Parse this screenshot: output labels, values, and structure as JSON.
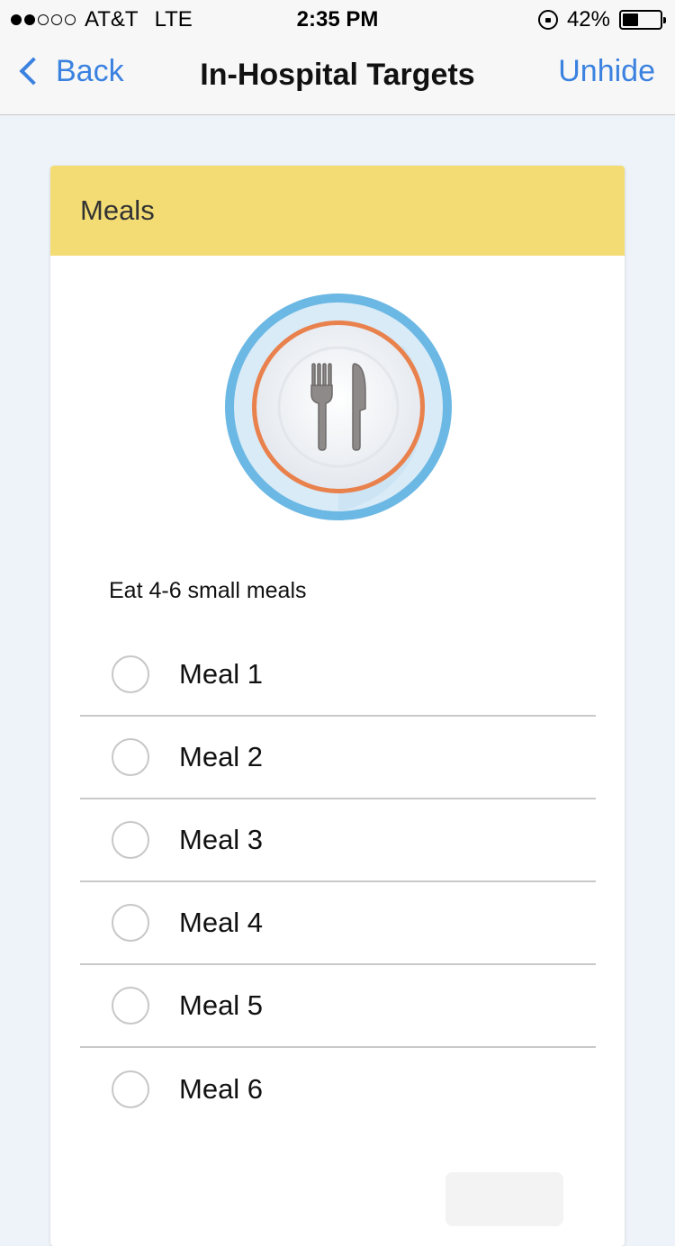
{
  "status_bar": {
    "carrier": "AT&T",
    "network": "LTE",
    "time": "2:35 PM",
    "battery_percent": "42%",
    "battery_level": 0.42,
    "signal_strength": 2,
    "signal_max": 5
  },
  "nav": {
    "back_label": "Back",
    "title": "In-Hospital Targets",
    "unhide_label": "Unhide"
  },
  "card": {
    "header": "Meals",
    "icon": "plate-fork-knife-icon",
    "description": "Eat 4-6 small meals",
    "meals": [
      {
        "label": "Meal 1",
        "checked": false
      },
      {
        "label": "Meal 2",
        "checked": false
      },
      {
        "label": "Meal 3",
        "checked": false
      },
      {
        "label": "Meal 4",
        "checked": false
      },
      {
        "label": "Meal 5",
        "checked": false
      },
      {
        "label": "Meal 6",
        "checked": false
      }
    ]
  },
  "colors": {
    "accent": "#3b82e0",
    "header_bg": "#f4dc74",
    "page_bg": "#edf3f8"
  }
}
